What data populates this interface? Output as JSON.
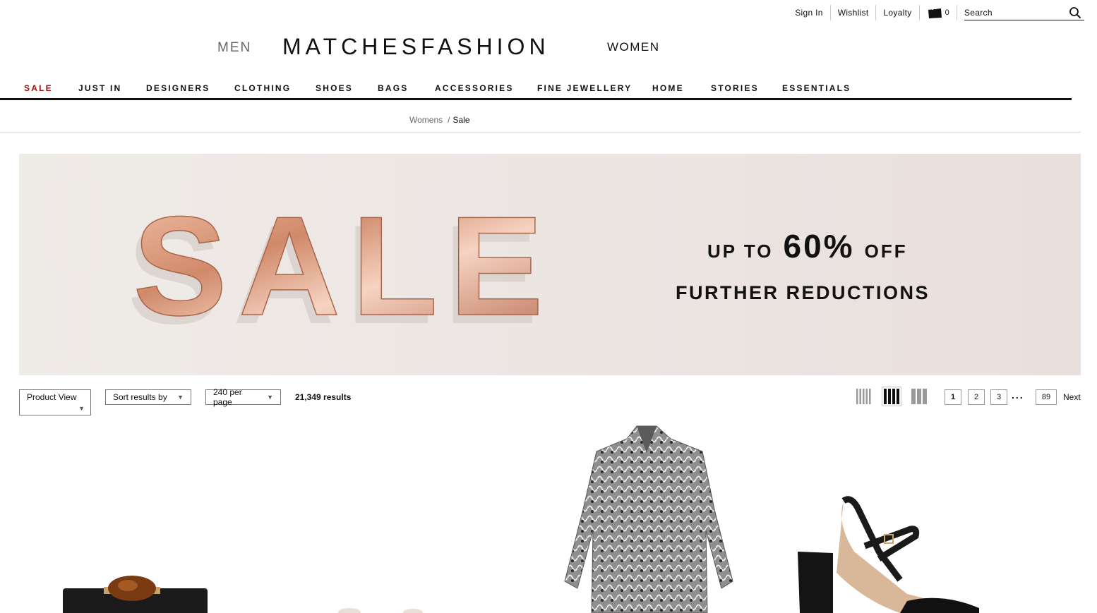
{
  "utility": {
    "sign_in": "Sign In",
    "wishlist": "Wishlist",
    "loyalty": "Loyalty",
    "bag_count": "0",
    "search_placeholder": "Search"
  },
  "header": {
    "men": "MEN",
    "logo": "MATCHESFASHION",
    "women": "WOMEN"
  },
  "nav": {
    "items": [
      "SALE",
      "JUST IN",
      "DESIGNERS",
      "CLOTHING",
      "SHOES",
      "BAGS",
      "ACCESSORIES",
      "FINE JEWELLERY",
      "HOME",
      "STORIES",
      "ESSENTIALS"
    ]
  },
  "breadcrumb": {
    "level1": "Womens",
    "separator": "/",
    "level2": "Sale"
  },
  "banner": {
    "art_text": "SALE",
    "up_to": "UP TO",
    "discount": "60%",
    "off": "OFF",
    "further": "FURTHER REDUCTIONS"
  },
  "toolbar": {
    "product_view": "Product View",
    "sort": "Sort results by",
    "per_page": "240 per page",
    "results": "21,349 results",
    "pages": [
      "1",
      "2",
      "3"
    ],
    "ellipsis": "...",
    "last_page": "89",
    "next": "Next"
  },
  "colors": {
    "sale_red": "#a10f0f",
    "banner_bg": "#ece6e3",
    "copper": "#d99a7e"
  }
}
